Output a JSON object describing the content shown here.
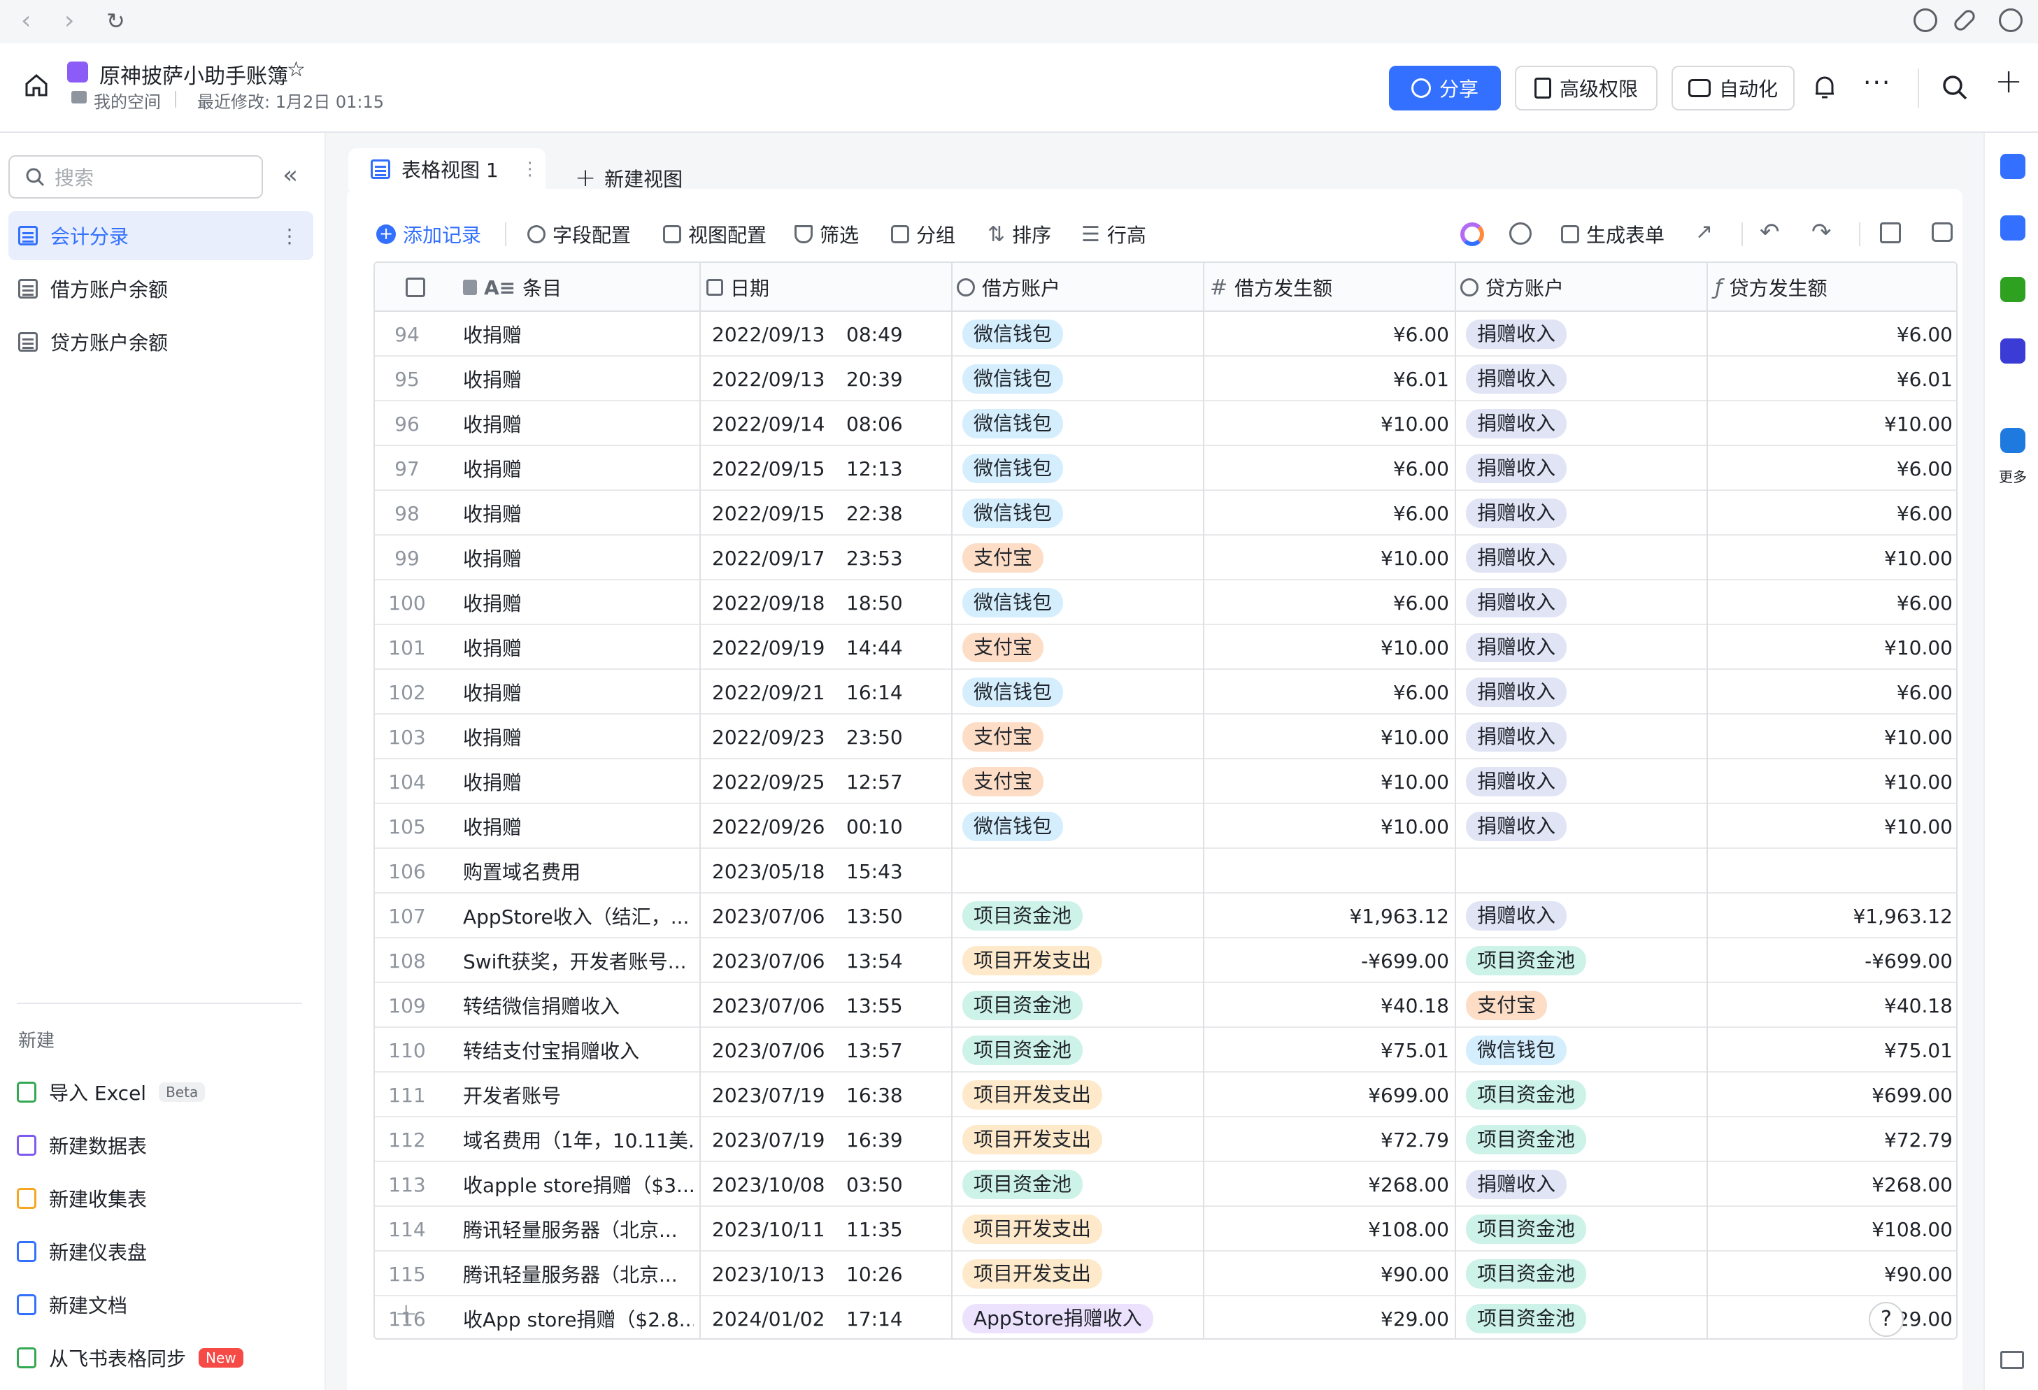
{
  "browser": {
    "back": "‹",
    "forward": "›",
    "reload": "↻"
  },
  "header": {
    "doc_title": "原神披萨小助手账簿",
    "location": "我的空间",
    "last_modified": "最近修改: 1月2日 01:15",
    "share_label": "分享",
    "permission_label": "高级权限",
    "automation_label": "自动化"
  },
  "sidebar": {
    "search_placeholder": "搜索",
    "tables": [
      {
        "label": "会计分录"
      },
      {
        "label": "借方账户余额"
      },
      {
        "label": "贷方账户余额"
      }
    ],
    "new_section_label": "新建",
    "new_items": [
      {
        "label": "导入 Excel",
        "badge": "Beta",
        "icon_color": "#34a853"
      },
      {
        "label": "新建数据表",
        "badge": "",
        "icon_color": "#7f5af0"
      },
      {
        "label": "新建收集表",
        "badge": "",
        "icon_color": "#f5a623"
      },
      {
        "label": "新建仪表盘",
        "badge": "",
        "icon_color": "#3370ff"
      },
      {
        "label": "新建文档",
        "badge": "",
        "icon_color": "#3370ff"
      },
      {
        "label": "从飞书表格同步",
        "badge": "New",
        "icon_color": "#34a853"
      }
    ]
  },
  "view_tabs": {
    "active": "表格视图 1",
    "new_view": "新建视图"
  },
  "toolbar": {
    "add_record": "添加记录",
    "field_config": "字段配置",
    "view_config": "视图配置",
    "filter": "筛选",
    "group": "分组",
    "sort": "排序",
    "row_height": "行高",
    "generate_form": "生成表单"
  },
  "columns": {
    "item": "条目",
    "date": "日期",
    "debit_account": "借方账户",
    "debit_amount": "借方发生额",
    "credit_account": "贷方账户",
    "credit_amount": "贷方发生额"
  },
  "tag_colors": {
    "微信钱包": {
      "bg": "#d5eefe",
      "fg": "#1f2329"
    },
    "支付宝": {
      "bg": "#fdddc6",
      "fg": "#1f2329"
    },
    "捐赠收入": {
      "bg": "#e0e4f5",
      "fg": "#1f2329"
    },
    "项目资金池": {
      "bg": "#cdf2e8",
      "fg": "#1f2329"
    },
    "项目开发支出": {
      "bg": "#feeacb",
      "fg": "#1f2329"
    },
    "AppStore捐赠收入": {
      "bg": "#ece2fe",
      "fg": "#1f2329"
    }
  },
  "rows": [
    {
      "n": "94",
      "item": "收捐赠",
      "date": "2022/09/13",
      "time": "08:49",
      "dacc": "微信钱包",
      "damt": "¥6.00",
      "cacc": "捐赠收入",
      "camt": "¥6.00"
    },
    {
      "n": "95",
      "item": "收捐赠",
      "date": "2022/09/13",
      "time": "20:39",
      "dacc": "微信钱包",
      "damt": "¥6.01",
      "cacc": "捐赠收入",
      "camt": "¥6.01"
    },
    {
      "n": "96",
      "item": "收捐赠",
      "date": "2022/09/14",
      "time": "08:06",
      "dacc": "微信钱包",
      "damt": "¥10.00",
      "cacc": "捐赠收入",
      "camt": "¥10.00"
    },
    {
      "n": "97",
      "item": "收捐赠",
      "date": "2022/09/15",
      "time": "12:13",
      "dacc": "微信钱包",
      "damt": "¥6.00",
      "cacc": "捐赠收入",
      "camt": "¥6.00"
    },
    {
      "n": "98",
      "item": "收捐赠",
      "date": "2022/09/15",
      "time": "22:38",
      "dacc": "微信钱包",
      "damt": "¥6.00",
      "cacc": "捐赠收入",
      "camt": "¥6.00"
    },
    {
      "n": "99",
      "item": "收捐赠",
      "date": "2022/09/17",
      "time": "23:53",
      "dacc": "支付宝",
      "damt": "¥10.00",
      "cacc": "捐赠收入",
      "camt": "¥10.00"
    },
    {
      "n": "100",
      "item": "收捐赠",
      "date": "2022/09/18",
      "time": "18:50",
      "dacc": "微信钱包",
      "damt": "¥6.00",
      "cacc": "捐赠收入",
      "camt": "¥6.00"
    },
    {
      "n": "101",
      "item": "收捐赠",
      "date": "2022/09/19",
      "time": "14:44",
      "dacc": "支付宝",
      "damt": "¥10.00",
      "cacc": "捐赠收入",
      "camt": "¥10.00"
    },
    {
      "n": "102",
      "item": "收捐赠",
      "date": "2022/09/21",
      "time": "16:14",
      "dacc": "微信钱包",
      "damt": "¥6.00",
      "cacc": "捐赠收入",
      "camt": "¥6.00"
    },
    {
      "n": "103",
      "item": "收捐赠",
      "date": "2022/09/23",
      "time": "23:50",
      "dacc": "支付宝",
      "damt": "¥10.00",
      "cacc": "捐赠收入",
      "camt": "¥10.00"
    },
    {
      "n": "104",
      "item": "收捐赠",
      "date": "2022/09/25",
      "time": "12:57",
      "dacc": "支付宝",
      "damt": "¥10.00",
      "cacc": "捐赠收入",
      "camt": "¥10.00"
    },
    {
      "n": "105",
      "item": "收捐赠",
      "date": "2022/09/26",
      "time": "00:10",
      "dacc": "微信钱包",
      "damt": "¥10.00",
      "cacc": "捐赠收入",
      "camt": "¥10.00"
    },
    {
      "n": "106",
      "item": "购置域名费用",
      "date": "2023/05/18",
      "time": "15:43",
      "dacc": "",
      "damt": "",
      "cacc": "",
      "camt": ""
    },
    {
      "n": "107",
      "item": "AppStore收入（结汇，...",
      "date": "2023/07/06",
      "time": "13:50",
      "dacc": "项目资金池",
      "damt": "¥1,963.12",
      "cacc": "捐赠收入",
      "camt": "¥1,963.12"
    },
    {
      "n": "108",
      "item": "Swift获奖，开发者账号...",
      "date": "2023/07/06",
      "time": "13:54",
      "dacc": "项目开发支出",
      "damt": "-¥699.00",
      "cacc": "项目资金池",
      "camt": "-¥699.00"
    },
    {
      "n": "109",
      "item": "转结微信捐赠收入",
      "date": "2023/07/06",
      "time": "13:55",
      "dacc": "项目资金池",
      "damt": "¥40.18",
      "cacc": "支付宝",
      "camt": "¥40.18"
    },
    {
      "n": "110",
      "item": "转结支付宝捐赠收入",
      "date": "2023/07/06",
      "time": "13:57",
      "dacc": "项目资金池",
      "damt": "¥75.01",
      "cacc": "微信钱包",
      "camt": "¥75.01"
    },
    {
      "n": "111",
      "item": "开发者账号",
      "date": "2023/07/19",
      "time": "16:38",
      "dacc": "项目开发支出",
      "damt": "¥699.00",
      "cacc": "项目资金池",
      "camt": "¥699.00"
    },
    {
      "n": "112",
      "item": "域名费用（1年，10.11美...",
      "date": "2023/07/19",
      "time": "16:39",
      "dacc": "项目开发支出",
      "damt": "¥72.79",
      "cacc": "项目资金池",
      "camt": "¥72.79"
    },
    {
      "n": "113",
      "item": "收apple store捐赠（$3...",
      "date": "2023/10/08",
      "time": "03:50",
      "dacc": "项目资金池",
      "damt": "¥268.00",
      "cacc": "捐赠收入",
      "camt": "¥268.00"
    },
    {
      "n": "114",
      "item": "腾讯轻量服务器（北京...",
      "date": "2023/10/11",
      "time": "11:35",
      "dacc": "项目开发支出",
      "damt": "¥108.00",
      "cacc": "项目资金池",
      "camt": "¥108.00"
    },
    {
      "n": "115",
      "item": "腾讯轻量服务器（北京...",
      "date": "2023/10/13",
      "time": "10:26",
      "dacc": "项目开发支出",
      "damt": "¥90.00",
      "cacc": "项目资金池",
      "camt": "¥90.00"
    },
    {
      "n": "116",
      "item": "收App store捐赠（$2.8...",
      "date": "2024/01/02",
      "time": "17:14",
      "dacc": "AppStore捐赠收入",
      "damt": "¥29.00",
      "cacc": "项目资金池",
      "camt": "¥29.00"
    }
  ],
  "rail": {
    "more_label": "更多"
  },
  "footer": {
    "add_row": "+",
    "help": "?"
  }
}
